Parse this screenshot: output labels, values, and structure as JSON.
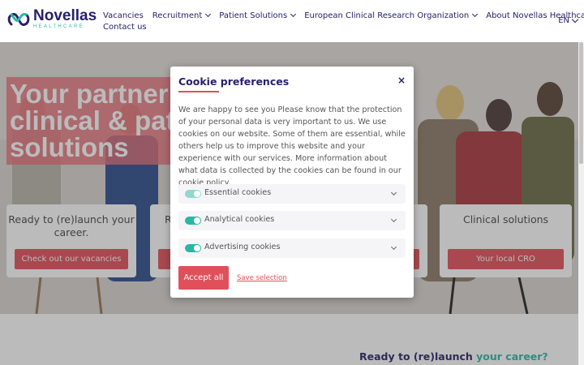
{
  "header": {
    "logo_name": "Novellas",
    "logo_sub": "HEALTHCARE",
    "nav": [
      {
        "label": "Vacancies",
        "has_caret": false
      },
      {
        "label": "Recruitment",
        "has_caret": true
      },
      {
        "label": "Patient Solutions",
        "has_caret": true
      },
      {
        "label": "European Clinical Research Organization",
        "has_caret": true
      },
      {
        "label": "About Novellas Healthcare",
        "has_caret": true
      }
    ],
    "nav_second_row": "Contact us",
    "language": "EN"
  },
  "hero": {
    "title": "Your partner\nclinical & pati\nsolutions",
    "cards": [
      {
        "text": "Ready to (re)launch your career.",
        "button": "Check out our vacancies"
      },
      {
        "text": "R",
        "button": ""
      },
      {
        "text": "",
        "button": ""
      },
      {
        "text": "Clinical solutions",
        "button": "Your local CRO"
      }
    ]
  },
  "section": {
    "title_main": "Ready to (re)launch ",
    "title_accent": "your career?"
  },
  "cookie_modal": {
    "title": "Cookie preferences",
    "close": "×",
    "description": "We are happy to see you    Please know that the protection of your personal data is very important to us. We use cookies on our website. Some of them are essential, while others help us to improve this website and your experience with our services. More information about what data is collected by the cookies can be found in our ",
    "policy_link": "cookie policy",
    "description_end": ".",
    "options": [
      {
        "label": "Essential cookies",
        "enabled": true,
        "disabled": true
      },
      {
        "label": "Analytical cookies",
        "enabled": true,
        "disabled": false
      },
      {
        "label": "Advertising cookies",
        "enabled": true,
        "disabled": false
      }
    ],
    "accept_all": "Accept all",
    "save_selection": "Save selection"
  },
  "colors": {
    "brand_navy": "#27206b",
    "brand_teal": "#2bb7a5",
    "accent_red": "#e0505a"
  }
}
